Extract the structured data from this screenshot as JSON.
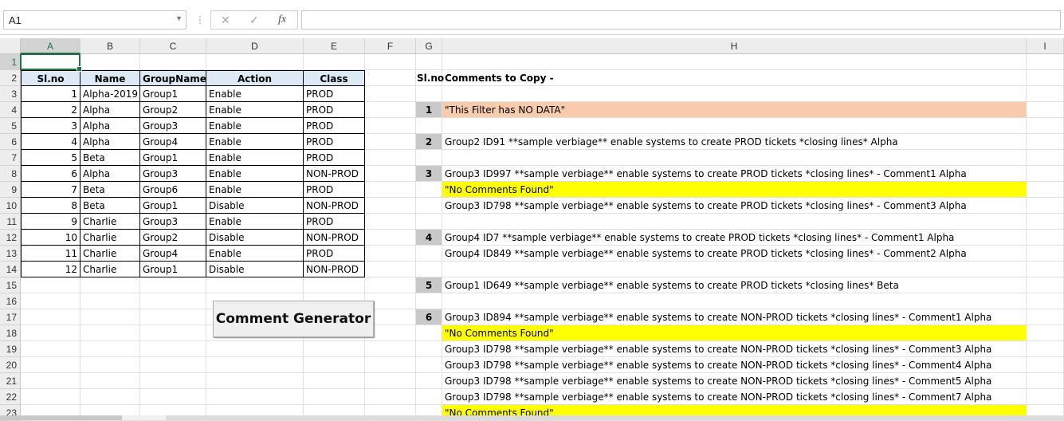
{
  "formula_bar": {
    "name_box": "A1",
    "separator_glyph": "⋮",
    "cancel_glyph": "✕",
    "enter_glyph": "✓",
    "fx_label": "fx",
    "formula_value": ""
  },
  "sheet": {
    "columns": [
      "A",
      "B",
      "C",
      "D",
      "E",
      "F",
      "G",
      "H",
      "I"
    ],
    "rows": [
      "1",
      "2",
      "3",
      "4",
      "5",
      "6",
      "7",
      "8",
      "9",
      "10",
      "11",
      "12",
      "13",
      "14",
      "15",
      "16",
      "17",
      "18",
      "19",
      "20",
      "21",
      "22",
      "23"
    ],
    "active_cell": "A1"
  },
  "table": {
    "headers": [
      "Sl.no",
      "Name",
      "GroupName",
      "Action",
      "Class"
    ],
    "rows": [
      [
        "1",
        "Alpha-2019",
        "Group1",
        "Enable",
        "PROD"
      ],
      [
        "2",
        "Alpha",
        "Group2",
        "Enable",
        "PROD"
      ],
      [
        "3",
        "Alpha",
        "Group3",
        "Enable",
        "PROD"
      ],
      [
        "4",
        "Alpha",
        "Group4",
        "Enable",
        "PROD"
      ],
      [
        "5",
        "Beta",
        "Group1",
        "Enable",
        "PROD"
      ],
      [
        "6",
        "Alpha",
        "Group3",
        "Enable",
        "NON-PROD"
      ],
      [
        "7",
        "Beta",
        "Group6",
        "Enable",
        "PROD"
      ],
      [
        "8",
        "Beta",
        "Group1",
        "Disable",
        "NON-PROD"
      ],
      [
        "9",
        "Charlie",
        "Group3",
        "Enable",
        "PROD"
      ],
      [
        "10",
        "Charlie",
        "Group2",
        "Disable",
        "NON-PROD"
      ],
      [
        "11",
        "Charlie",
        "Group4",
        "Enable",
        "PROD"
      ],
      [
        "12",
        "Charlie",
        "Group1",
        "Disable",
        "NON-PROD"
      ]
    ]
  },
  "button": {
    "label": "Comment Generator"
  },
  "comments": {
    "header_slno": "Sl.no",
    "header_title": "Comments to Copy -",
    "rows": [
      {
        "row": 4,
        "num": "1",
        "text": "\"This Filter has NO DATA\"",
        "fill": "#f8cbad"
      },
      {
        "row": 6,
        "num": "2",
        "text": "Group2 ID91 **sample verbiage** enable systems to create PROD tickets *closing lines* Alpha",
        "fill": ""
      },
      {
        "row": 8,
        "num": "3",
        "text": "Group3 ID997 **sample verbiage** enable systems to create PROD tickets *closing lines*  - Comment1 Alpha",
        "fill": ""
      },
      {
        "row": 9,
        "num": "",
        "text": "\"No Comments Found\"",
        "fill": "#ffff00"
      },
      {
        "row": 10,
        "num": "",
        "text": "Group3 ID798 **sample verbiage** enable systems to create PROD tickets *closing lines*  - Comment3 Alpha",
        "fill": ""
      },
      {
        "row": 12,
        "num": "4",
        "text": "Group4 ID7 **sample verbiage** enable systems to create PROD tickets *closing lines*  - Comment1 Alpha",
        "fill": ""
      },
      {
        "row": 13,
        "num": "",
        "text": "Group4 ID849 **sample verbiage** enable systems to create PROD tickets *closing lines*  - Comment2 Alpha",
        "fill": ""
      },
      {
        "row": 15,
        "num": "5",
        "text": "Group1 ID649 **sample verbiage** enable systems to create PROD tickets *closing lines* Beta",
        "fill": ""
      },
      {
        "row": 17,
        "num": "6",
        "text": "Group3 ID894 **sample verbiage** enable systems to create NON-PROD tickets *closing lines*  - Comment1 Alpha",
        "fill": ""
      },
      {
        "row": 18,
        "num": "",
        "text": "\"No Comments Found\"",
        "fill": "#ffff00"
      },
      {
        "row": 19,
        "num": "",
        "text": "Group3 ID798 **sample verbiage** enable systems to create NON-PROD tickets *closing lines*  - Comment3 Alpha",
        "fill": ""
      },
      {
        "row": 20,
        "num": "",
        "text": "Group3 ID798 **sample verbiage** enable systems to create NON-PROD tickets *closing lines*  - Comment4 Alpha",
        "fill": ""
      },
      {
        "row": 21,
        "num": "",
        "text": "Group3 ID798 **sample verbiage** enable systems to create NON-PROD tickets *closing lines*  - Comment5 Alpha",
        "fill": ""
      },
      {
        "row": 22,
        "num": "",
        "text": "Group3 ID798 **sample verbiage** enable systems to create NON-PROD tickets *closing lines*  - Comment7 Alpha",
        "fill": ""
      },
      {
        "row": 23,
        "num": "",
        "text": "\"No Comments Found\"",
        "fill": "#ffff00"
      }
    ]
  },
  "colors": {
    "accent": "#217346",
    "header_fill": "#dde9f5",
    "number_box": "#c9c9c9"
  }
}
